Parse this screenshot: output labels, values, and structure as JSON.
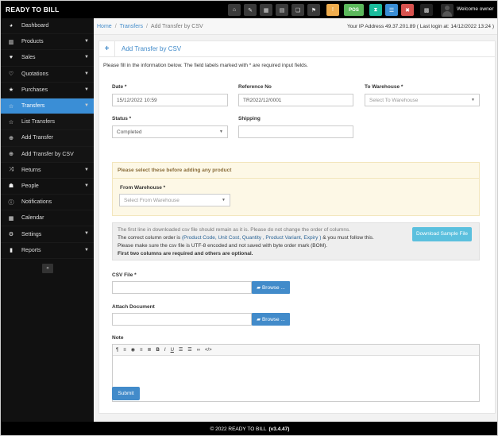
{
  "brand": "READY TO BILL",
  "topbar": {
    "pos_label": "POS",
    "owner_label": "Welcome owner",
    "colors": {
      "gray": "#3a3a3a",
      "yellow": "#f0ad4e",
      "green": "#5cb85c",
      "teal": "#1abc9c",
      "blue": "#3a8ed6",
      "red": "#d9534f"
    }
  },
  "sidebar": {
    "items": [
      {
        "label": "Dashboard",
        "icon": "dashboard-icon",
        "chev": false,
        "active": false
      },
      {
        "label": "Products",
        "icon": "barcode-icon",
        "chev": true,
        "active": false
      },
      {
        "label": "Sales",
        "icon": "heart-icon",
        "chev": true,
        "active": false
      },
      {
        "label": "Quotations",
        "icon": "heart-outline-icon",
        "chev": true,
        "active": false
      },
      {
        "label": "Purchases",
        "icon": "star-icon",
        "chev": true,
        "active": false
      },
      {
        "label": "Transfers",
        "icon": "star-outline-icon",
        "chev": true,
        "active": true
      },
      {
        "label": "List Transfers",
        "icon": "star-outline-icon",
        "chev": false,
        "active": false,
        "sub": true
      },
      {
        "label": "Add Transfer",
        "icon": "plus-circle-icon",
        "chev": false,
        "active": false,
        "sub": true
      },
      {
        "label": "Add Transfer by CSV",
        "icon": "plus-circle-icon",
        "chev": false,
        "active": false,
        "sub": true
      },
      {
        "label": "Returns",
        "icon": "random-icon",
        "chev": true,
        "active": false
      },
      {
        "label": "People",
        "icon": "users-icon",
        "chev": true,
        "active": false
      },
      {
        "label": "Notifications",
        "icon": "info-circle-icon",
        "chev": false,
        "active": false
      },
      {
        "label": "Calendar",
        "icon": "calendar-icon",
        "chev": false,
        "active": false
      },
      {
        "label": "Settings",
        "icon": "cog-icon",
        "chev": true,
        "active": false
      },
      {
        "label": "Reports",
        "icon": "bar-chart-icon",
        "chev": true,
        "active": false
      }
    ]
  },
  "breadcrumb": {
    "home": "Home",
    "transfers": "Transfers",
    "current": "Add Transfer by CSV"
  },
  "ipinfo": "Your IP Address 49.37.201.89 ( Last login at: 14/12/2022 13:24 )",
  "panel": {
    "title": "Add Transfer by CSV",
    "intro": "Please fill in the information below. The field labels marked with * are required input fields."
  },
  "form": {
    "date": {
      "label": "Date *",
      "value": "15/12/2022 10:59"
    },
    "reference": {
      "label": "Reference No",
      "value": "TR2022/12/0001"
    },
    "to_warehouse": {
      "label": "To Warehouse *",
      "placeholder": "Select To Warehouse"
    },
    "status": {
      "label": "Status *",
      "value": "Completed"
    },
    "shipping": {
      "label": "Shipping",
      "value": ""
    },
    "warn": "Please select these before adding any product",
    "from_warehouse": {
      "label": "From Warehouse *",
      "placeholder": "Select From Warehouse"
    },
    "info": {
      "line1": "The first line in downloaded csv file should remain as it is. Please do not change the order of columns.",
      "line2_pre": "The correct column order is",
      "line2_cols": "(Product Code, Unit Cost, Quantity , Product Variant, Expiry )",
      "line2_post": "& you must follow this.",
      "line3": "Please make sure the csv file is UTF-8 encoded and not saved with byte order mark (BOM).",
      "line4": "First two columns are required and others are optional.",
      "download_label": "Download Sample File"
    },
    "csv_file": {
      "label": "CSV File *",
      "browse": "Browse ..."
    },
    "attach": {
      "label": "Attach Document",
      "browse": "Browse ..."
    },
    "note": {
      "label": "Note"
    },
    "submit": "Submit"
  },
  "footer": {
    "text": "© 2022 READY TO BILL",
    "version": "(v3.4.47)"
  }
}
